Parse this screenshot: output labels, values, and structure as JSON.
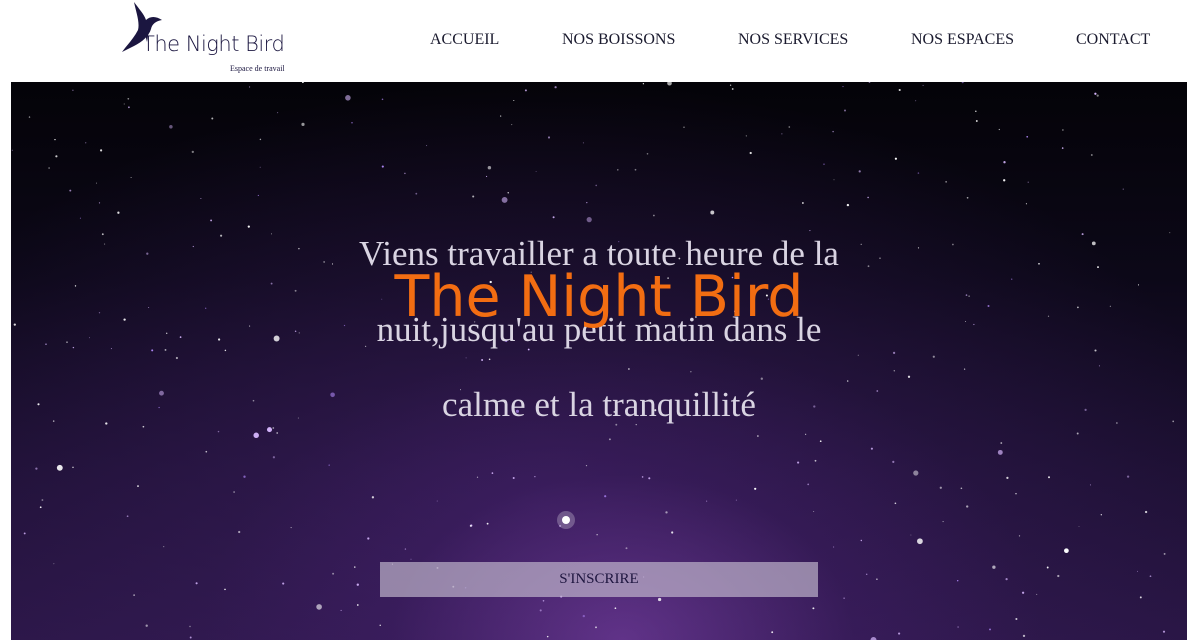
{
  "brand": {
    "name": "The Night Bird",
    "tagline": "Espace de travail",
    "logo_icon": "bird-silhouette",
    "color": "#1b1640"
  },
  "nav": {
    "items": [
      {
        "label": "ACCUEIL"
      },
      {
        "label": "NOS BOISSONS"
      },
      {
        "label": "NOS SERVICES"
      },
      {
        "label": "NOS ESPACES"
      },
      {
        "label": "CONTACT"
      }
    ]
  },
  "hero": {
    "lines": [
      "Viens travailler a toute heure de la",
      "nuit,jusqu'au petit matin dans le",
      "calme et la tranquillité"
    ],
    "title": "The Night Bird",
    "title_color": "#f26d12",
    "cta_label": "S'INSCRIRE",
    "background": "starry-night-sky"
  }
}
